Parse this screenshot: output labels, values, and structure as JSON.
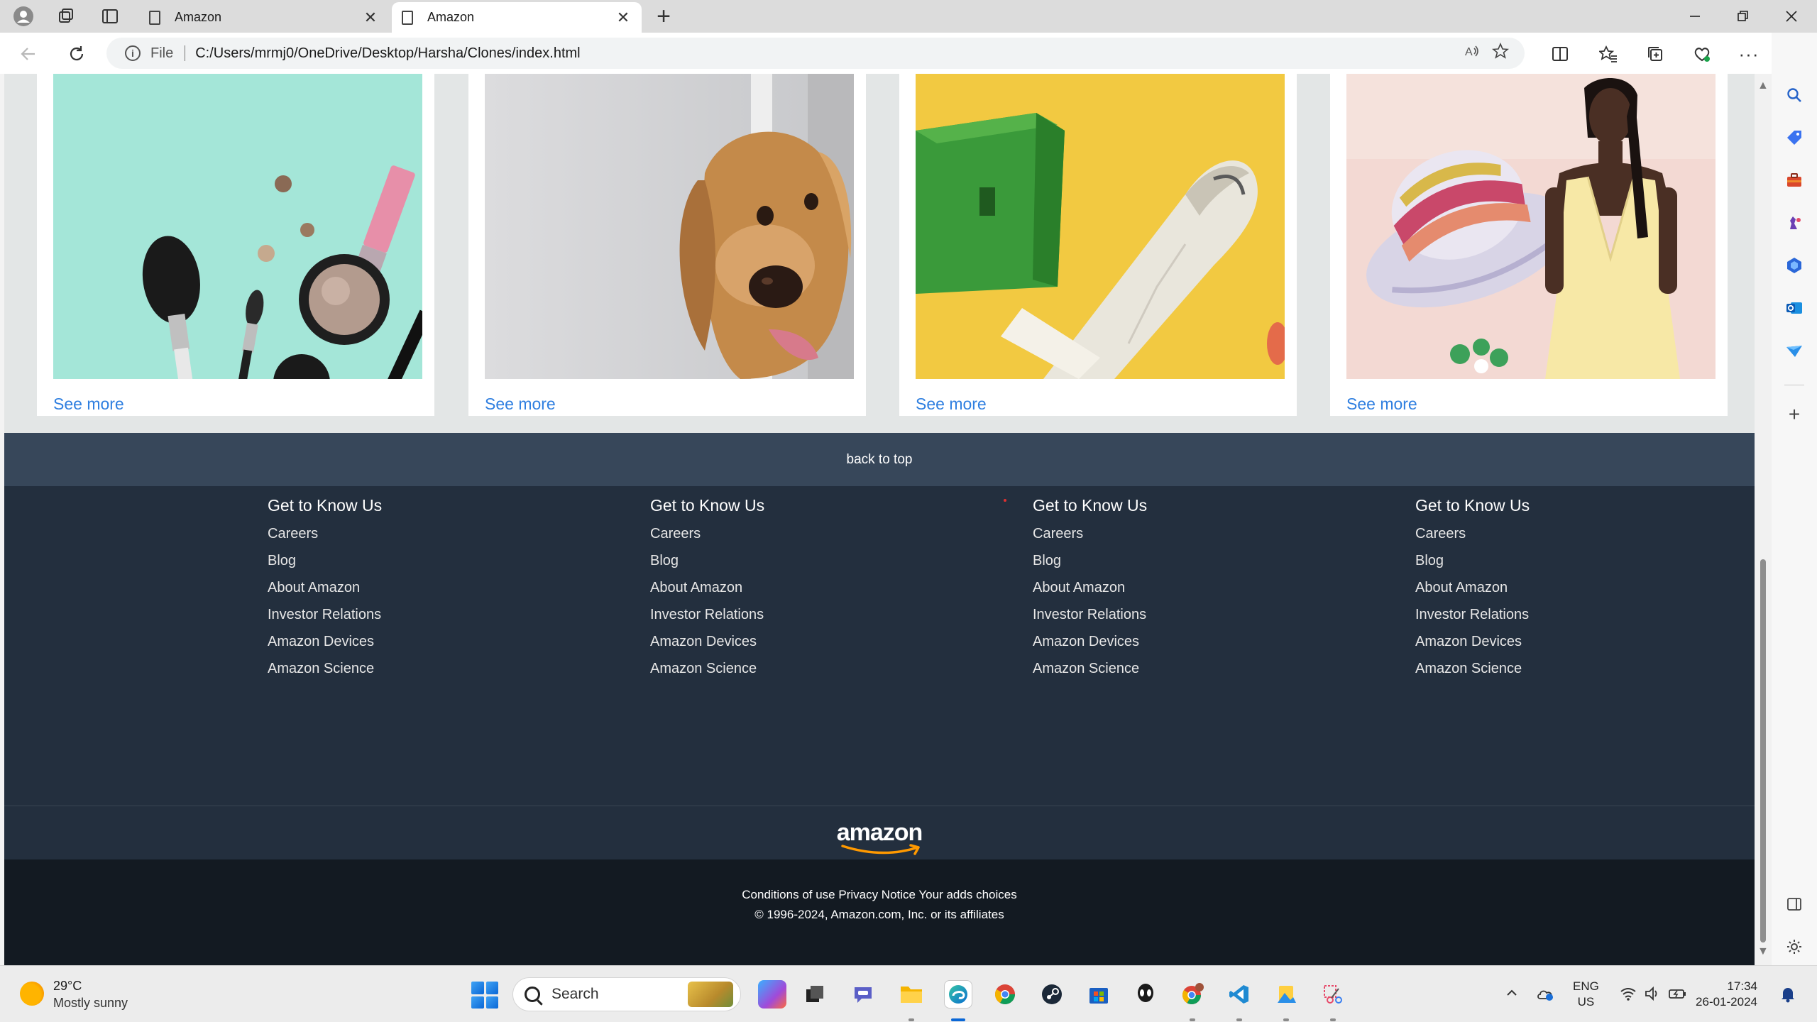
{
  "browser": {
    "tabs": [
      {
        "title": "Amazon",
        "active": false
      },
      {
        "title": "Amazon",
        "active": true
      }
    ],
    "address": {
      "protocol_label": "File",
      "url": "C:/Users/mrmj0/OneDrive/Desktop/Harsha/Clones/index.html"
    },
    "new_tab_symbol": "+",
    "icons": [
      "profile-icon",
      "workspaces-icon",
      "tab-actions-icon",
      "back-icon",
      "refresh-icon",
      "read-aloud-icon",
      "favorite-icon",
      "split-screen-icon",
      "favorites-icon",
      "collections-icon",
      "browser-essentials-icon",
      "more-icon",
      "copilot-icon"
    ]
  },
  "page": {
    "cards": [
      {
        "image": "makeup-flatlay",
        "link": "See more"
      },
      {
        "image": "golden-retriever",
        "link": "See more"
      },
      {
        "image": "toy-airplane",
        "link": "See more"
      },
      {
        "image": "fashion-hat-dress",
        "link": "See more"
      }
    ],
    "back_to_top": "back to top",
    "footer_columns": [
      {
        "heading": "Get to Know Us",
        "links": [
          "Careers",
          "Blog",
          "About Amazon",
          "Investor Relations",
          "Amazon Devices",
          "Amazon Science"
        ]
      },
      {
        "heading": "Get to Know Us",
        "links": [
          "Careers",
          "Blog",
          "About Amazon",
          "Investor Relations",
          "Amazon Devices",
          "Amazon Science"
        ]
      },
      {
        "heading": "Get to Know Us",
        "links": [
          "Careers",
          "Blog",
          "About Amazon",
          "Investor Relations",
          "Amazon Devices",
          "Amazon Science"
        ]
      },
      {
        "heading": "Get to Know Us",
        "links": [
          "Careers",
          "Blog",
          "About Amazon",
          "Investor Relations",
          "Amazon Devices",
          "Amazon Science"
        ]
      }
    ],
    "logo_text": "amazon",
    "legal_links": "Conditions of use Privacy Notice Your adds choices",
    "copyright": "© 1996-2024, Amazon.com, Inc. or its affiliates"
  },
  "taskbar": {
    "weather": {
      "temp": "29°C",
      "condition": "Mostly sunny"
    },
    "search_placeholder": "Search",
    "tray": {
      "lang_line1": "ENG",
      "lang_line2": "US",
      "time": "17:34",
      "date": "26-01-2024"
    }
  },
  "colors": {
    "link_blue": "#2f7fe0",
    "back_to_top_bg": "#37475a",
    "footer_bg": "#232f3e",
    "footer_bottom_bg": "#131a22",
    "logo_smile": "#ff9900"
  }
}
